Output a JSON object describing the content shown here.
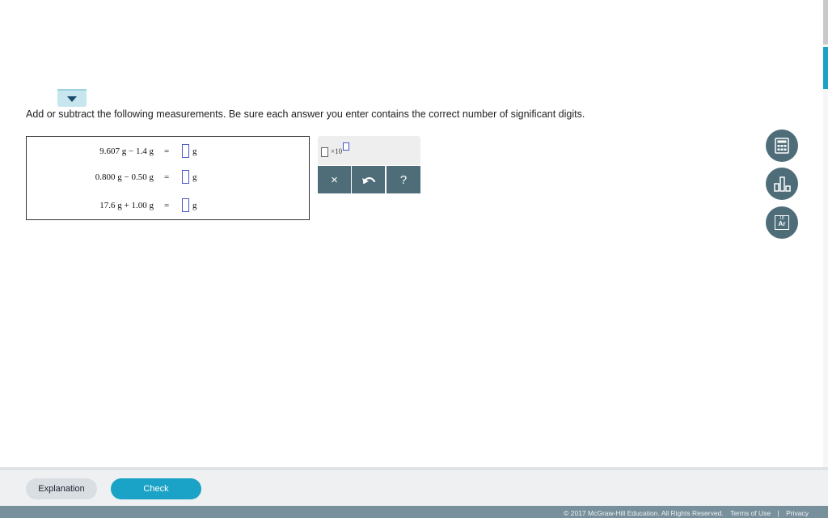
{
  "question": {
    "instructions": "Add or subtract the following measurements. Be sure each answer you enter contains the correct number of significant digits.",
    "rows": [
      {
        "expression": "9.607 g − 1.4 g",
        "equals": "=",
        "unit": "g"
      },
      {
        "expression": "0.800 g − 0.50 g",
        "equals": "=",
        "unit": "g"
      },
      {
        "expression": "17.6 g + 1.00 g",
        "equals": "=",
        "unit": "g"
      }
    ]
  },
  "tools": {
    "sci_notation": "×10",
    "clear_label": "×",
    "undo_icon": "undo-arrow",
    "help_label": "?"
  },
  "side_tools": {
    "calculator_icon": "calculator",
    "chart_icon": "bar-chart",
    "periodic_icon_top": "18",
    "periodic_icon_label": "Ar"
  },
  "footer": {
    "explanation_label": "Explanation",
    "check_label": "Check",
    "copyright": "© 2017 McGraw-Hill Education. All Rights Reserved.",
    "terms": "Terms of Use",
    "separator": "|",
    "privacy": "Privacy"
  },
  "colors": {
    "accent": "#1aa3c6",
    "tool_button": "#4e6d79",
    "input_border": "#4a57c8"
  }
}
